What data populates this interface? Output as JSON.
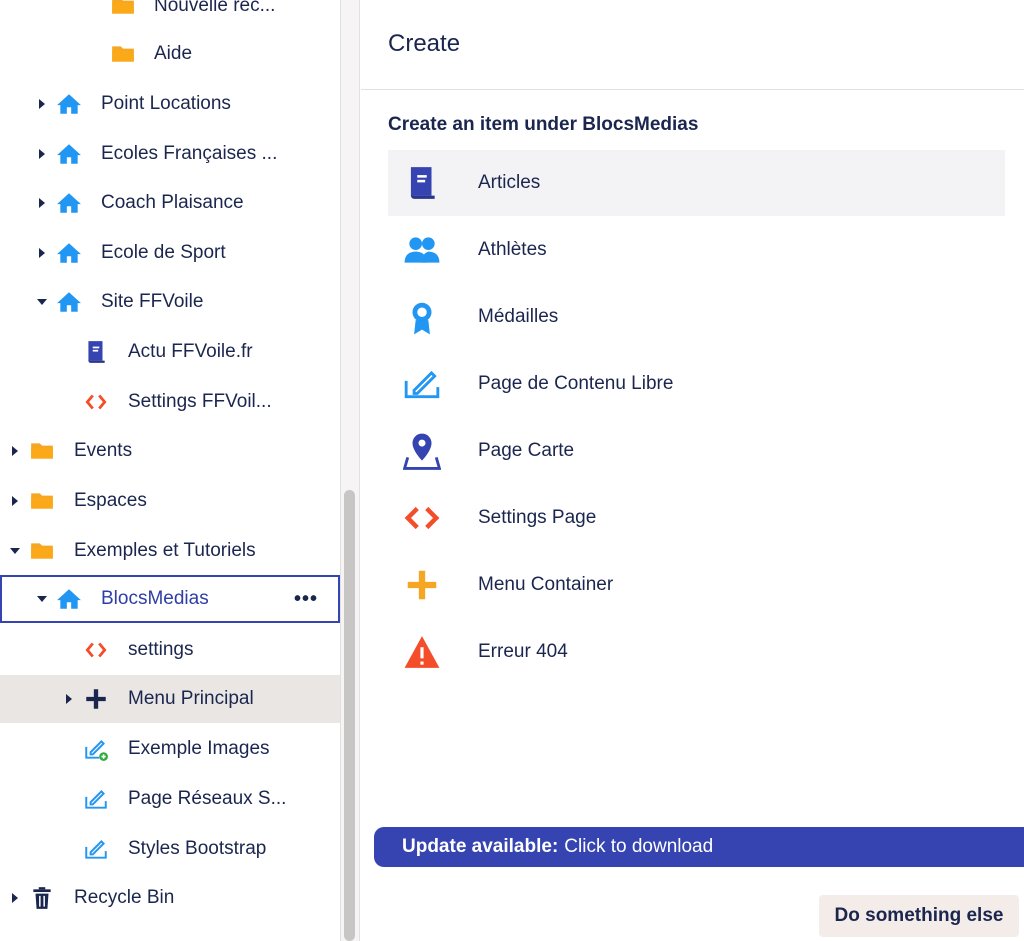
{
  "tree": {
    "items": [
      {
        "label": "Nouvelle rec...",
        "icon": "folder-icon"
      },
      {
        "label": "Aide",
        "icon": "folder-icon"
      },
      {
        "label": "Point Locations",
        "icon": "home-icon"
      },
      {
        "label": "Ecoles Françaises ...",
        "icon": "home-icon"
      },
      {
        "label": "Coach Plaisance",
        "icon": "home-icon"
      },
      {
        "label": "Ecole de Sport",
        "icon": "home-icon"
      },
      {
        "label": "Site FFVoile",
        "icon": "home-icon"
      },
      {
        "label": "Actu FFVoile.fr",
        "icon": "book-icon"
      },
      {
        "label": "Settings FFVoil...",
        "icon": "code-icon"
      },
      {
        "label": "Events",
        "icon": "folder-icon"
      },
      {
        "label": "Espaces",
        "icon": "folder-icon"
      },
      {
        "label": "Exemples et Tutoriels",
        "icon": "folder-icon"
      },
      {
        "label": "BlocsMedias",
        "icon": "home-icon",
        "actions": "•••"
      },
      {
        "label": "settings",
        "icon": "code-icon"
      },
      {
        "label": "Menu Principal",
        "icon": "plus-icon"
      },
      {
        "label": "Exemple Images",
        "icon": "edit-add-icon"
      },
      {
        "label": "Page Réseaux S...",
        "icon": "edit-icon"
      },
      {
        "label": "Styles Bootstrap",
        "icon": "edit-icon"
      },
      {
        "label": "Recycle Bin",
        "icon": "trash-icon"
      }
    ]
  },
  "create": {
    "title": "Create",
    "subtitle": "Create an item under BlocsMedias",
    "items": [
      {
        "label": "Articles",
        "icon": "book-icon"
      },
      {
        "label": "Athlètes",
        "icon": "users-icon"
      },
      {
        "label": "Médailles",
        "icon": "medal-icon"
      },
      {
        "label": "Page de Contenu Libre",
        "icon": "edit-icon"
      },
      {
        "label": "Page Carte",
        "icon": "map-pin-icon"
      },
      {
        "label": "Settings Page",
        "icon": "code-icon"
      },
      {
        "label": "Menu Container",
        "icon": "plus-icon"
      },
      {
        "label": "Erreur 404",
        "icon": "warning-icon"
      }
    ]
  },
  "update": {
    "bold": "Update available:",
    "text": "Click to download"
  },
  "footer": {
    "do_something_else": "Do something else"
  },
  "colors": {
    "folder": "#f5a623",
    "home": "#2196f3",
    "book": "#3544b1",
    "code": "#f44d2a",
    "accent": "#3544b1"
  }
}
